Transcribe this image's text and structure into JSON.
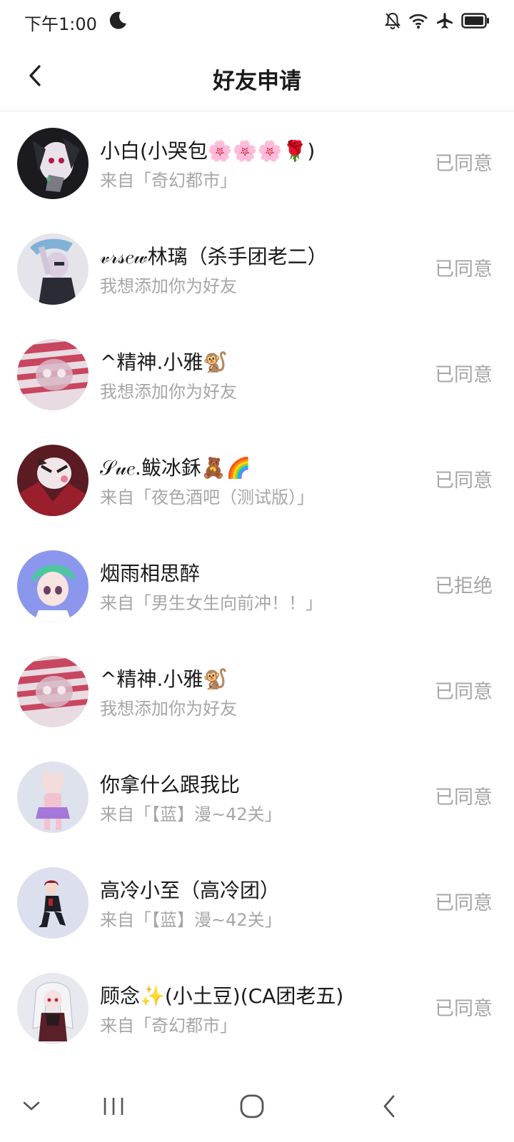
{
  "status_bar": {
    "time": "下午1:00"
  },
  "header": {
    "title": "好友申请"
  },
  "requests": [
    {
      "name": "小白(小哭包🌸🌸🌸🌹)",
      "source": "来自「奇幻都市」",
      "status": "已同意"
    },
    {
      "name": "𝓋𝓇𝓈𝑒𝓌林璃（杀手团老二）",
      "source": "我想添加你为好友",
      "status": "已同意"
    },
    {
      "name": "^精神.小雅🐒",
      "source": "我想添加你为好友",
      "status": "已同意"
    },
    {
      "name": "𝒮𝓊𝑒.鲅冰鉌🧸🌈",
      "source": "来自「夜色酒吧（测试版）」",
      "status": "已同意"
    },
    {
      "name": "烟雨相思醉",
      "source": "来自「男生女生向前冲！！」",
      "status": "已拒绝"
    },
    {
      "name": "^精神.小雅🐒",
      "source": "我想添加你为好友",
      "status": "已同意"
    },
    {
      "name": "你拿什么跟我比",
      "source": "来自「【蓝】漫~42关」",
      "status": "已同意"
    },
    {
      "name": "高冷小至（高冷团）",
      "source": "来自「【蓝】漫~42关」",
      "status": "已同意"
    },
    {
      "name": "顾念✨(小土豆)(CA团老五)",
      "source": "来自「奇幻都市」",
      "status": "已同意"
    }
  ],
  "icons": {
    "status_bar": [
      "moon-icon",
      "bell-off-icon",
      "wifi-icon",
      "airplane-icon",
      "battery-icon"
    ],
    "header": [
      "back-arrow-icon"
    ],
    "nav_bar": [
      "chevron-down-icon",
      "recent-apps-icon",
      "home-icon",
      "back-icon"
    ]
  },
  "colors": {
    "primary_text": "#1a1a1a",
    "secondary_text": "#a6a6a6",
    "divider": "#e6e6e6"
  }
}
